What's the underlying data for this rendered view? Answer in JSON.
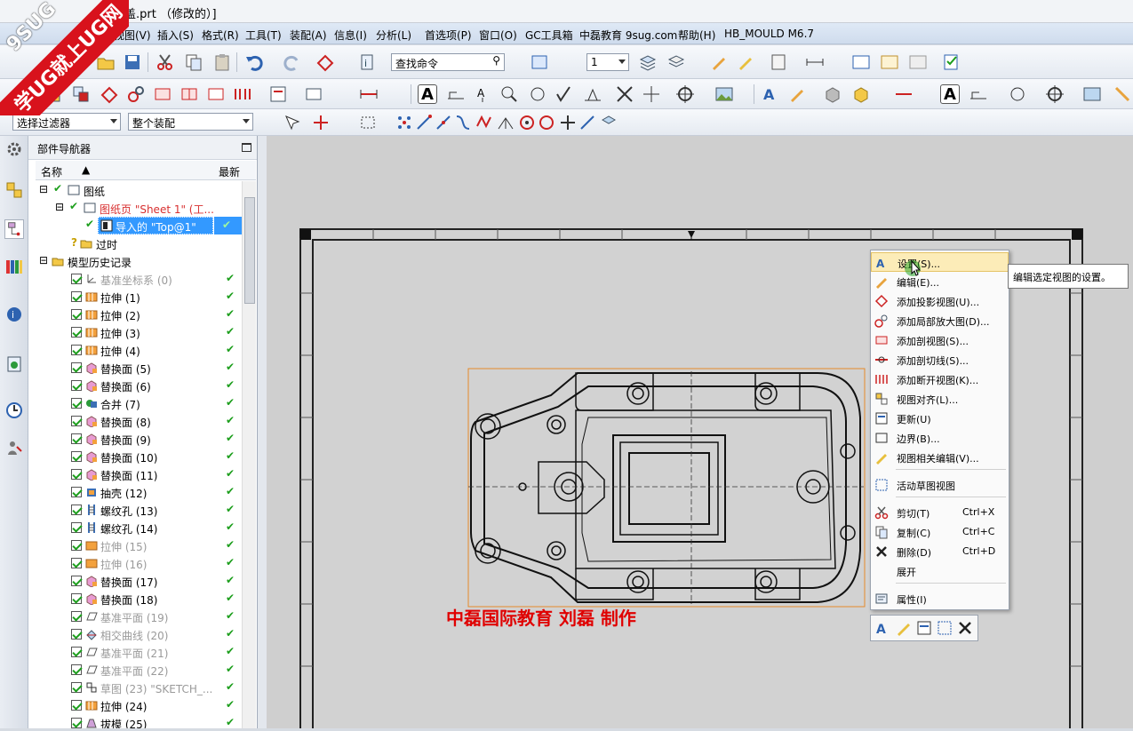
{
  "window": {
    "title": "盖.prt （修改的）]"
  },
  "menu": [
    "视图(V)",
    "插入(S)",
    "格式(R)",
    "工具(T)",
    "装配(A)",
    "信息(I)",
    "分析(L)",
    "首选项(P)",
    "窗口(O)",
    "GC工具箱",
    "中磊教育 9sug.com",
    "帮助(H)",
    "HB_MOULD M6.7"
  ],
  "toolbar": {
    "search_placeholder": "查找命令",
    "layer_value": "1",
    "selection_filter": "选择过滤器",
    "assembly_scope": "整个装配"
  },
  "navigator": {
    "title": "部件导航器",
    "col_name": "名称",
    "col_latest": "最新",
    "rows": [
      {
        "label": "图纸",
        "style": "normal"
      },
      {
        "label": "图纸页 \"Sheet 1\" (工...",
        "style": "red"
      },
      {
        "label": "导入的 \"Top@1\"",
        "style": "sel"
      },
      {
        "label": "过时",
        "style": "normal"
      },
      {
        "label": "模型历史记录",
        "style": "normal"
      },
      {
        "label": "基准坐标系 (0)",
        "style": "gray"
      },
      {
        "label": "拉伸 (1)",
        "style": "normal"
      },
      {
        "label": "拉伸 (2)",
        "style": "normal"
      },
      {
        "label": "拉伸 (3)",
        "style": "normal"
      },
      {
        "label": "拉伸 (4)",
        "style": "normal"
      },
      {
        "label": "替换面 (5)",
        "style": "normal"
      },
      {
        "label": "替换面 (6)",
        "style": "normal"
      },
      {
        "label": "合并 (7)",
        "style": "normal"
      },
      {
        "label": "替换面 (8)",
        "style": "normal"
      },
      {
        "label": "替换面 (9)",
        "style": "normal"
      },
      {
        "label": "替换面 (10)",
        "style": "normal"
      },
      {
        "label": "替换面 (11)",
        "style": "normal"
      },
      {
        "label": "抽壳 (12)",
        "style": "normal"
      },
      {
        "label": "螺纹孔 (13)",
        "style": "normal"
      },
      {
        "label": "螺纹孔 (14)",
        "style": "normal"
      },
      {
        "label": "拉伸 (15)",
        "style": "gray"
      },
      {
        "label": "拉伸 (16)",
        "style": "gray"
      },
      {
        "label": "替换面 (17)",
        "style": "normal"
      },
      {
        "label": "替换面 (18)",
        "style": "normal"
      },
      {
        "label": "基准平面 (19)",
        "style": "gray"
      },
      {
        "label": "相交曲线 (20)",
        "style": "gray"
      },
      {
        "label": "基准平面 (21)",
        "style": "gray"
      },
      {
        "label": "基准平面 (22)",
        "style": "gray"
      },
      {
        "label": "草图 (23) \"SKETCH_...",
        "style": "gray"
      },
      {
        "label": "拉伸 (24)",
        "style": "normal"
      },
      {
        "label": "拔模 (25)",
        "style": "normal"
      }
    ]
  },
  "context_menu": {
    "items": [
      {
        "label": "设置(S)...",
        "shortcut": ""
      },
      {
        "label": "编辑(E)...",
        "shortcut": ""
      },
      {
        "label": "添加投影视图(U)...",
        "shortcut": ""
      },
      {
        "label": "添加局部放大图(D)...",
        "shortcut": ""
      },
      {
        "label": "添加剖视图(S)...",
        "shortcut": ""
      },
      {
        "label": "添加剖切线(S)...",
        "shortcut": ""
      },
      {
        "label": "添加断开视图(K)...",
        "shortcut": ""
      },
      {
        "label": "视图对齐(L)...",
        "shortcut": ""
      },
      {
        "label": "更新(U)",
        "shortcut": ""
      },
      {
        "label": "边界(B)...",
        "shortcut": ""
      },
      {
        "label": "视图相关编辑(V)...",
        "shortcut": ""
      },
      {
        "label": "活动草图视图",
        "shortcut": ""
      },
      {
        "label": "剪切(T)",
        "shortcut": "Ctrl+X"
      },
      {
        "label": "复制(C)",
        "shortcut": "Ctrl+C"
      },
      {
        "label": "删除(D)",
        "shortcut": "Ctrl+D"
      },
      {
        "label": "展开",
        "shortcut": ""
      },
      {
        "label": "属性(I)",
        "shortcut": ""
      }
    ],
    "tooltip": "编辑选定视图的设置。"
  },
  "watermark": {
    "line1": "9SUG",
    "line2": "学UG就上UG网"
  },
  "drawing_credit": "中磊国际教育  刘磊  制作",
  "colors": {
    "accent": "#3399ff",
    "check": "#1c9e1c",
    "credit": "#e00000",
    "highlight": "#fcecb8"
  }
}
